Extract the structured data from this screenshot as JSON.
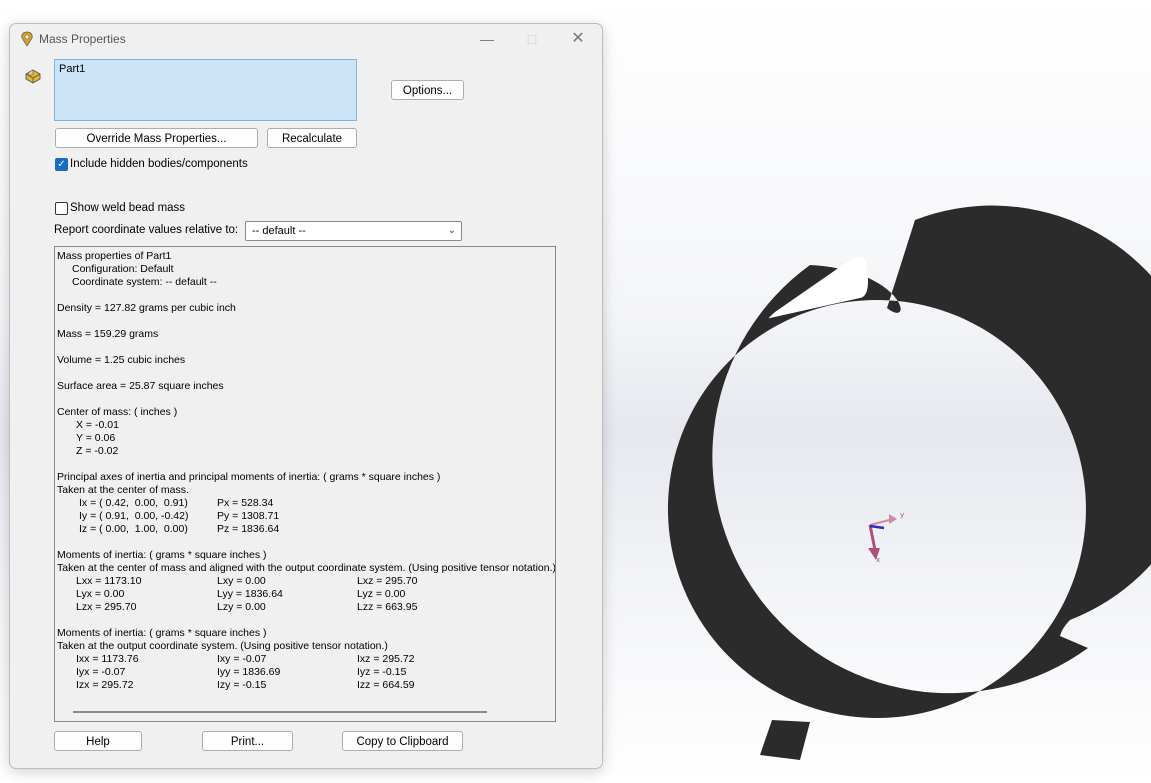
{
  "dialog": {
    "title": "Mass Properties",
    "selection": "Part1",
    "options_label": "Options...",
    "override_label": "Override Mass Properties...",
    "recalculate_label": "Recalculate",
    "include_hidden_label": "Include hidden bodies/components",
    "include_hidden_checked": true,
    "weld_bead_label": "Show weld bead mass",
    "weld_bead_checked": false,
    "coord_label": "Report coordinate values relative to:",
    "coord_value": "-- default --",
    "help_label": "Help",
    "print_label": "Print...",
    "copy_label": "Copy to Clipboard"
  },
  "report": {
    "header": "Mass properties of Part1",
    "config": "Configuration: Default",
    "coordsys": "Coordinate system: -- default --",
    "density": "Density = 127.82 grams per cubic inch",
    "mass": "Mass = 159.29 grams",
    "volume": "Volume = 1.25 cubic inches",
    "surface": "Surface area = 25.87 square inches",
    "com_title": "Center of mass: ( inches )",
    "com_x": "X = -0.01",
    "com_y": "Y = 0.06",
    "com_z": "Z = -0.02",
    "pa_title": "Principal axes of inertia and principal moments of inertia: ( grams * square inches )",
    "pa_sub": "Taken at the center of mass.",
    "ix": "Ix = ( 0.42,  0.00,  0.91)",
    "iy": "Iy = ( 0.91,  0.00, -0.42)",
    "iz": "Iz = ( 0.00,  1.00,  0.00)",
    "px": "Px = 528.34",
    "py": "Py = 1308.71",
    "pz": "Pz = 1836.64",
    "moi1_title": "Moments of inertia: ( grams * square inches )",
    "moi1_sub": "Taken at the center of mass and aligned with the output coordinate system. (Using positive tensor notation.)",
    "lxx": "Lxx = 1173.10",
    "lxy": "Lxy = 0.00",
    "lxz": "Lxz = 295.70",
    "lyx": "Lyx = 0.00",
    "lyy": "Lyy = 1836.64",
    "lyz": "Lyz = 0.00",
    "lzx": "Lzx = 295.70",
    "lzy": "Lzy = 0.00",
    "lzz": "Lzz = 663.95",
    "moi2_title": "Moments of inertia: ( grams * square inches )",
    "moi2_sub": "Taken at the output coordinate system. (Using positive tensor notation.)",
    "ixx": "Ixx = 1173.76",
    "ixy": "Ixy = -0.07",
    "ixz": "Ixz = 295.72",
    "iyx": "Iyx = -0.07",
    "iyy": "Iyy = 1836.69",
    "iyz": "Iyz = -0.15",
    "izx": "Izx = 295.72",
    "izy": "Izy = -0.15",
    "izz": "Izz = 664.59"
  },
  "viewport": {
    "part_color": "#2b2b2b",
    "triad_labels": {
      "x": "x",
      "y": "y"
    }
  }
}
